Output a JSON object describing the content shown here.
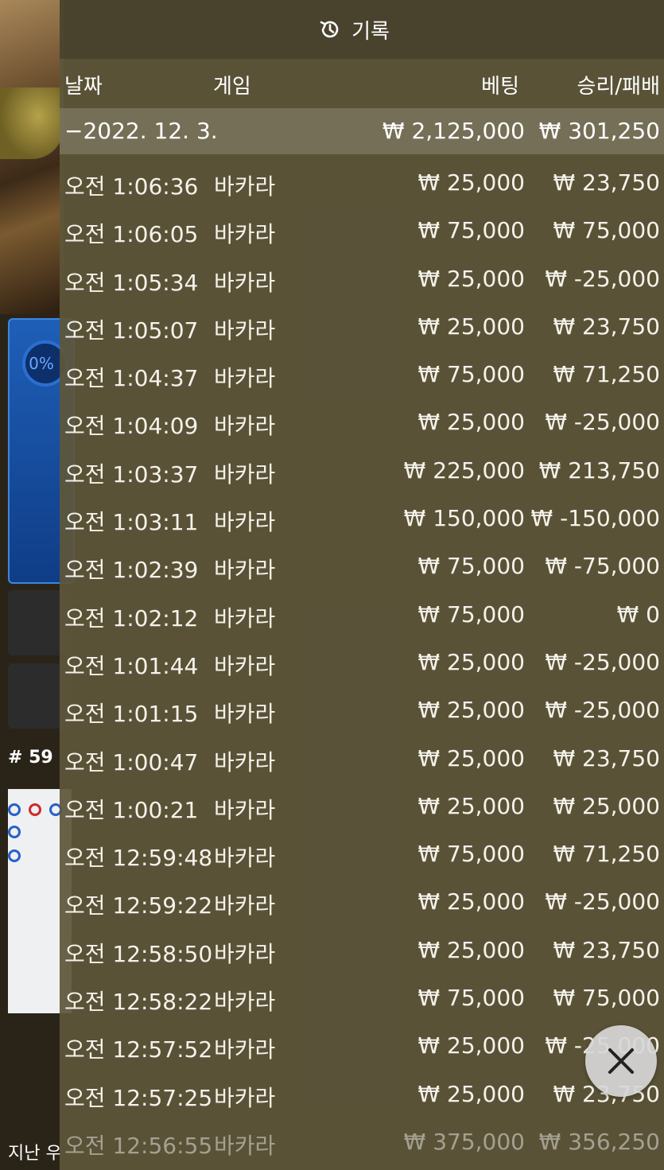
{
  "background": {
    "percent_label": "0%",
    "round_label": "# 59",
    "bottom_label": "지난 우"
  },
  "panel": {
    "title": "기록",
    "icon": "history-icon",
    "columns": {
      "date": "날짜",
      "game": "게임",
      "bet": "베팅",
      "result": "승리/패배"
    },
    "summary": {
      "date": "−2022. 12. 3.",
      "bet": "₩ 2,125,000",
      "result": "₩ 301,250"
    },
    "rows": [
      {
        "time": "오전 1:06:36",
        "game": "바카라",
        "bet": "₩ 25,000",
        "result": "₩ 23,750"
      },
      {
        "time": "오전 1:06:05",
        "game": "바카라",
        "bet": "₩ 75,000",
        "result": "₩ 75,000"
      },
      {
        "time": "오전 1:05:34",
        "game": "바카라",
        "bet": "₩ 25,000",
        "result": "₩ -25,000"
      },
      {
        "time": "오전 1:05:07",
        "game": "바카라",
        "bet": "₩ 25,000",
        "result": "₩ 23,750"
      },
      {
        "time": "오전 1:04:37",
        "game": "바카라",
        "bet": "₩ 75,000",
        "result": "₩ 71,250"
      },
      {
        "time": "오전 1:04:09",
        "game": "바카라",
        "bet": "₩ 25,000",
        "result": "₩ -25,000"
      },
      {
        "time": "오전 1:03:37",
        "game": "바카라",
        "bet": "₩ 225,000",
        "result": "₩ 213,750"
      },
      {
        "time": "오전 1:03:11",
        "game": "바카라",
        "bet": "₩ 150,000",
        "result": "₩ -150,000"
      },
      {
        "time": "오전 1:02:39",
        "game": "바카라",
        "bet": "₩ 75,000",
        "result": "₩ -75,000"
      },
      {
        "time": "오전 1:02:12",
        "game": "바카라",
        "bet": "₩ 75,000",
        "result": "₩ 0"
      },
      {
        "time": "오전 1:01:44",
        "game": "바카라",
        "bet": "₩ 25,000",
        "result": "₩ -25,000"
      },
      {
        "time": "오전 1:01:15",
        "game": "바카라",
        "bet": "₩ 25,000",
        "result": "₩ -25,000"
      },
      {
        "time": "오전 1:00:47",
        "game": "바카라",
        "bet": "₩ 25,000",
        "result": "₩ 23,750"
      },
      {
        "time": "오전 1:00:21",
        "game": "바카라",
        "bet": "₩ 25,000",
        "result": "₩ 25,000"
      },
      {
        "time": "오전 12:59:48",
        "game": "바카라",
        "bet": "₩ 75,000",
        "result": "₩ 71,250"
      },
      {
        "time": "오전 12:59:22",
        "game": "바카라",
        "bet": "₩ 25,000",
        "result": "₩ -25,000"
      },
      {
        "time": "오전 12:58:50",
        "game": "바카라",
        "bet": "₩ 25,000",
        "result": "₩ 23,750"
      },
      {
        "time": "오전 12:58:22",
        "game": "바카라",
        "bet": "₩ 75,000",
        "result": "₩ 75,000"
      },
      {
        "time": "오전 12:57:52",
        "game": "바카라",
        "bet": "₩ 25,000",
        "result": "₩ -25,000"
      },
      {
        "time": "오전 12:57:25",
        "game": "바카라",
        "bet": "₩ 25,000",
        "result": "₩ 23,750"
      },
      {
        "time": "오전 12:56:55",
        "game": "바카라",
        "bet": "₩ 375,000",
        "result": "₩ 356,250"
      }
    ],
    "close_icon": "close-icon"
  }
}
